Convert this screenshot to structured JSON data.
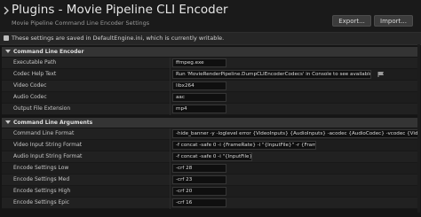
{
  "header": {
    "title": "Plugins - Movie Pipeline CLI Encoder",
    "subtitle": "Movie Pipeline Command Line Encoder Settings",
    "export_label": "Export...",
    "import_label": "Import..."
  },
  "notice": {
    "text": "These settings are saved in DefaultEngine.ini, which is currently writable."
  },
  "sections": [
    {
      "label": "Command Line Encoder",
      "rows": [
        {
          "name": "Executable Path",
          "value": "ffmpeg.exe"
        },
        {
          "name": "Codec Help Text",
          "value": "Run 'MovieRenderPipeline.DumpCLIEncoderCodecs' in Console to see available codecs."
        },
        {
          "name": "Video Codec",
          "value": "libx264"
        },
        {
          "name": "Audio Codec",
          "value": "aac"
        },
        {
          "name": "Output File Extension",
          "value": "mp4"
        }
      ]
    },
    {
      "label": "Command Line Arguments",
      "rows": [
        {
          "name": "Command Line Format",
          "value": "-hide_banner -y -loglevel error {VideoInputs} {AudioInputs} -acodec {AudioCodec} -vcodec {VideoCodec} {Quality} \"{OutputPath}\""
        },
        {
          "name": "Video Input String Format",
          "value": "-f concat -safe 0 -i {FrameRate} -i \"{InputFile}\" -r {FrameRate}"
        },
        {
          "name": "Audio Input String Format",
          "value": "-f concat -safe 0 -i \"{InputFile}\""
        },
        {
          "name": "Encode Settings Low",
          "value": "-crf 28"
        },
        {
          "name": "Encode Settings Med",
          "value": "-crf 23"
        },
        {
          "name": "Encode Settings High",
          "value": "-crf 20"
        },
        {
          "name": "Encode Settings Epic",
          "value": "-crf 16"
        }
      ]
    }
  ]
}
